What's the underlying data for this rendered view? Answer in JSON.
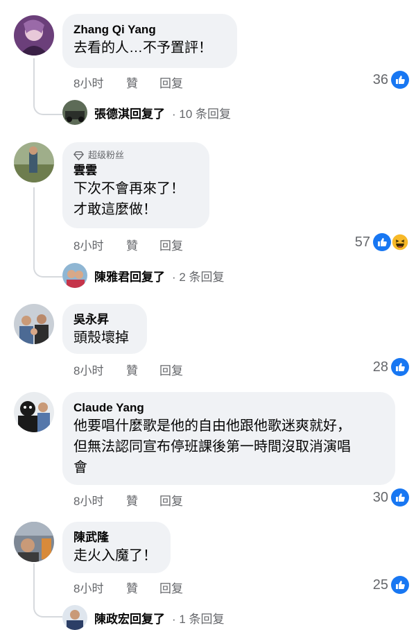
{
  "comments": [
    {
      "name": "Zhang Qi Yang",
      "lines": [
        "去看的人…不予置評！"
      ],
      "time": "8小时",
      "like": "贊",
      "reply": "回复",
      "count": "36",
      "reply_summary": {
        "name": "張德淇回复了",
        "count": " · 10 条回复"
      }
    },
    {
      "badge": "超级粉丝",
      "name": "雲雲",
      "lines": [
        "下次不會再來了！",
        "才敢這麼做！"
      ],
      "time": "8小时",
      "like": "贊",
      "reply": "回复",
      "count": "57",
      "reply_summary": {
        "name": "陳雅君回复了",
        "count": " · 2 条回复"
      }
    },
    {
      "name": "吳永昇",
      "lines": [
        "頭殼壞掉"
      ],
      "time": "8小时",
      "like": "贊",
      "reply": "回复",
      "count": "28"
    },
    {
      "name": "Claude Yang",
      "lines": [
        "他要唱什麼歌是他的自由他跟他歌迷爽就好，",
        "但無法認同宣布停班課後第一時間沒取消演唱",
        "會"
      ],
      "time": "8小时",
      "like": "贊",
      "reply": "回复",
      "count": "30"
    },
    {
      "name": "陳武隆",
      "lines": [
        "走火入魔了！"
      ],
      "time": "8小时",
      "like": "贊",
      "reply": "回复",
      "count": "25",
      "reply_summary": {
        "name": "陳政宏回复了",
        "count": " · 1 条回复"
      }
    }
  ],
  "colors": {
    "like_blue": "#1877f2",
    "bubble": "#f0f2f5",
    "meta": "#65676b"
  }
}
